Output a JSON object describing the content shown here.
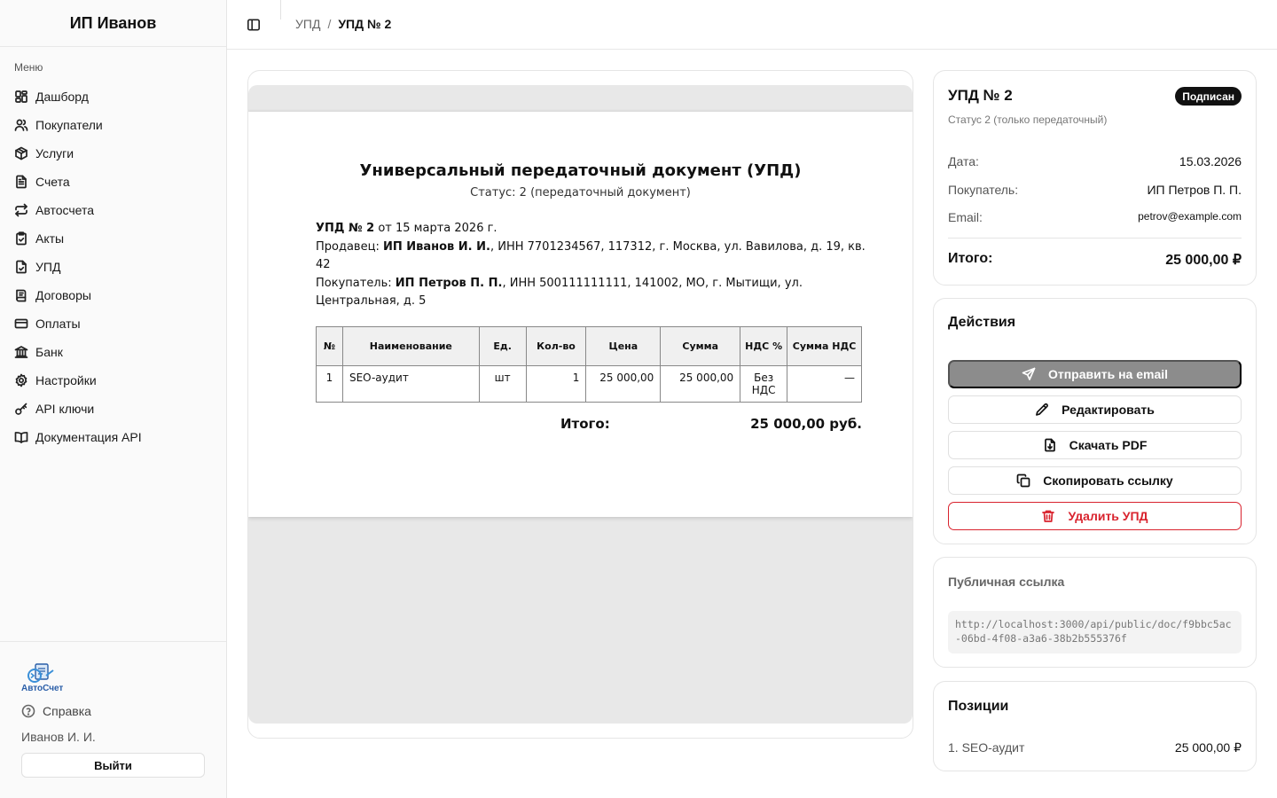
{
  "sidebar": {
    "brand": "ИП Иванов",
    "menu_caption": "Меню",
    "items": [
      {
        "label": "Дашборд",
        "icon": "dashboard-icon"
      },
      {
        "label": "Покупатели",
        "icon": "users-icon"
      },
      {
        "label": "Услуги",
        "icon": "box-icon"
      },
      {
        "label": "Счета",
        "icon": "file-text-icon"
      },
      {
        "label": "Автосчета",
        "icon": "repeat-icon"
      },
      {
        "label": "Акты",
        "icon": "clipboard-check-icon"
      },
      {
        "label": "УПД",
        "icon": "file-check-icon"
      },
      {
        "label": "Договоры",
        "icon": "book-open-text-icon"
      },
      {
        "label": "Оплаты",
        "icon": "credit-card-icon"
      },
      {
        "label": "Банк",
        "icon": "bank-icon"
      },
      {
        "label": "Настройки",
        "icon": "settings-icon"
      },
      {
        "label": "API ключи",
        "icon": "key-icon"
      },
      {
        "label": "Документация API",
        "icon": "book-open-icon"
      }
    ],
    "logo_text": "АвтоСчет",
    "help_label": "Справка",
    "user_name": "Иванов И. И.",
    "logout_label": "Выйти"
  },
  "topbar": {
    "breadcrumb_parent": "УПД",
    "breadcrumb_sep": "/",
    "breadcrumb_current": "УПД № 2"
  },
  "document": {
    "title": "Универсальный передаточный документ (УПД)",
    "subtitle": "Статус: 2 (передаточный документ)",
    "number_bold": "УПД № 2",
    "number_rest": " от 15 марта 2026 г.",
    "seller_label": "Продавец: ",
    "seller_name": "ИП Иванов И. И.",
    "seller_details": ", ИНН 7701234567, 117312, г. Москва, ул. Вавилова, д. 19, кв. 42",
    "buyer_label": "Покупатель: ",
    "buyer_name": "ИП Петров П. П.",
    "buyer_details": ", ИНН 500111111111, 141002, МО, г. Мытищи, ул. Центральная, д. 5",
    "table_headers": [
      "№",
      "Наименование",
      "Ед.",
      "Кол-во",
      "Цена",
      "Сумма",
      "НДС %",
      "Сумма НДС"
    ],
    "rows": [
      {
        "num": "1",
        "name": "SEO-аудит",
        "unit": "шт",
        "qty": "1",
        "price": "25 000,00",
        "sum": "25 000,00",
        "vat": "Без НДС",
        "vat_sum": "—"
      }
    ],
    "total_label": "Итого:",
    "total_value": "25 000,00 руб."
  },
  "summary": {
    "title": "УПД № 2",
    "badge": "Подписан",
    "subtitle": "Статус 2 (только передаточный)",
    "date_label": "Дата:",
    "date_value": "15.03.2026",
    "buyer_label": "Покупатель:",
    "buyer_value": "ИП Петров П. П.",
    "email_label": "Email:",
    "email_value": "petrov@example.com",
    "total_label": "Итого:",
    "total_value": "25 000,00 ₽"
  },
  "actions": {
    "title": "Действия",
    "send": "Отправить на email",
    "edit": "Редактировать",
    "download": "Скачать PDF",
    "copy": "Скопировать ссылку",
    "delete": "Удалить УПД"
  },
  "public_link": {
    "title": "Публичная ссылка",
    "url": "http://localhost:3000/api/public/doc/f9bbc5ac-06bd-4f08-a3a6-38b2b555376f"
  },
  "positions": {
    "title": "Позиции",
    "items": [
      {
        "name": "1. SEO-аудит",
        "value": "25 000,00 ₽"
      }
    ]
  },
  "colors": {
    "accent_danger": "#d9232e",
    "badge_bg": "#111111",
    "send_button_bg": "#8c8c8c",
    "logo_blue": "#2a5ea8"
  }
}
